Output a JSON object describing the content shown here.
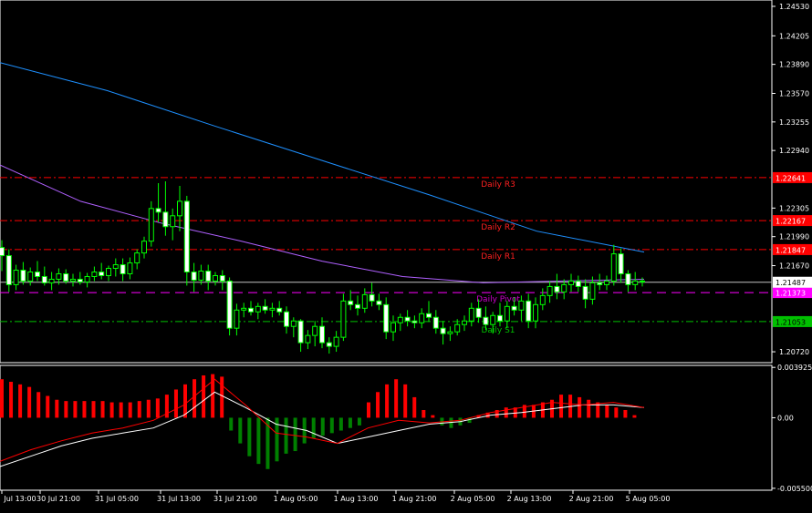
{
  "chart_data": [
    {
      "type": "candlestick",
      "title": "",
      "price_axis": {
        "ticks": [
          "1.24530",
          "1.24205",
          "1.23890",
          "1.23570",
          "1.23255",
          "1.22940",
          "1.22305",
          "1.21990",
          "1.21670",
          "1.20720"
        ],
        "ylim": [
          1.206,
          1.246
        ]
      },
      "levels": [
        {
          "name": "Daily R3",
          "value": 1.22641,
          "value_label": "1.22641",
          "color": "#ff0000",
          "style": "dashdot",
          "label_color": "#ff2020"
        },
        {
          "name": "Daily R2",
          "value": 1.22167,
          "value_label": "1.22167",
          "color": "#ff0000",
          "style": "dashdot",
          "label_color": "#ff2020"
        },
        {
          "name": "Daily R1",
          "value": 1.21847,
          "value_label": "1.21847",
          "color": "#ff0000",
          "style": "dashdot",
          "label_color": "#ff2020"
        },
        {
          "name": "Daily Pivot",
          "value": 1.21373,
          "value_label": "1.21373",
          "color": "#ff00ff",
          "style": "dashed",
          "label_color": "#cc00cc"
        },
        {
          "name": "Daily S1",
          "value": 1.21053,
          "value_label": "1.21053",
          "color": "#00c000",
          "style": "dashdot",
          "label_color": "#00c000"
        }
      ],
      "current_price": {
        "value": 1.21487,
        "label": "1.21487"
      },
      "candles": [
        {
          "o": 1.2187,
          "h": 1.2195,
          "l": 1.2161,
          "c": 1.2178
        },
        {
          "o": 1.2178,
          "h": 1.2185,
          "l": 1.2138,
          "c": 1.2146
        },
        {
          "o": 1.2146,
          "h": 1.2168,
          "l": 1.214,
          "c": 1.2162
        },
        {
          "o": 1.2162,
          "h": 1.2171,
          "l": 1.2146,
          "c": 1.215
        },
        {
          "o": 1.215,
          "h": 1.2165,
          "l": 1.2145,
          "c": 1.216
        },
        {
          "o": 1.216,
          "h": 1.2172,
          "l": 1.215,
          "c": 1.2155
        },
        {
          "o": 1.2155,
          "h": 1.2166,
          "l": 1.2145,
          "c": 1.2148
        },
        {
          "o": 1.2148,
          "h": 1.216,
          "l": 1.214,
          "c": 1.2152
        },
        {
          "o": 1.2152,
          "h": 1.2164,
          "l": 1.2146,
          "c": 1.2158
        },
        {
          "o": 1.2158,
          "h": 1.2163,
          "l": 1.2147,
          "c": 1.215
        },
        {
          "o": 1.215,
          "h": 1.2158,
          "l": 1.2144,
          "c": 1.2152
        },
        {
          "o": 1.2152,
          "h": 1.216,
          "l": 1.2146,
          "c": 1.2149
        },
        {
          "o": 1.2149,
          "h": 1.2159,
          "l": 1.2143,
          "c": 1.2155
        },
        {
          "o": 1.2155,
          "h": 1.2166,
          "l": 1.215,
          "c": 1.216
        },
        {
          "o": 1.216,
          "h": 1.217,
          "l": 1.2152,
          "c": 1.2156
        },
        {
          "o": 1.2156,
          "h": 1.2167,
          "l": 1.215,
          "c": 1.2164
        },
        {
          "o": 1.2164,
          "h": 1.2175,
          "l": 1.2155,
          "c": 1.2168
        },
        {
          "o": 1.2168,
          "h": 1.2175,
          "l": 1.215,
          "c": 1.2158
        },
        {
          "o": 1.2158,
          "h": 1.2176,
          "l": 1.2152,
          "c": 1.217
        },
        {
          "o": 1.217,
          "h": 1.2185,
          "l": 1.2163,
          "c": 1.2181
        },
        {
          "o": 1.2181,
          "h": 1.2199,
          "l": 1.2175,
          "c": 1.2194
        },
        {
          "o": 1.2194,
          "h": 1.2238,
          "l": 1.2188,
          "c": 1.223
        },
        {
          "o": 1.223,
          "h": 1.2258,
          "l": 1.2215,
          "c": 1.2226
        },
        {
          "o": 1.2226,
          "h": 1.226,
          "l": 1.22,
          "c": 1.221
        },
        {
          "o": 1.221,
          "h": 1.223,
          "l": 1.2195,
          "c": 1.2222
        },
        {
          "o": 1.2222,
          "h": 1.2255,
          "l": 1.2205,
          "c": 1.2238
        },
        {
          "o": 1.2238,
          "h": 1.2244,
          "l": 1.2145,
          "c": 1.216
        },
        {
          "o": 1.216,
          "h": 1.217,
          "l": 1.2138,
          "c": 1.2151
        },
        {
          "o": 1.2151,
          "h": 1.2168,
          "l": 1.2146,
          "c": 1.2161
        },
        {
          "o": 1.2161,
          "h": 1.2168,
          "l": 1.214,
          "c": 1.215
        },
        {
          "o": 1.215,
          "h": 1.216,
          "l": 1.2145,
          "c": 1.2156
        },
        {
          "o": 1.2156,
          "h": 1.2162,
          "l": 1.214,
          "c": 1.215
        },
        {
          "o": 1.215,
          "h": 1.2154,
          "l": 1.209,
          "c": 1.2098
        },
        {
          "o": 1.2098,
          "h": 1.2125,
          "l": 1.209,
          "c": 1.2118
        },
        {
          "o": 1.2118,
          "h": 1.2126,
          "l": 1.211,
          "c": 1.212
        },
        {
          "o": 1.212,
          "h": 1.2128,
          "l": 1.2112,
          "c": 1.2116
        },
        {
          "o": 1.2116,
          "h": 1.2126,
          "l": 1.2108,
          "c": 1.2122
        },
        {
          "o": 1.2122,
          "h": 1.213,
          "l": 1.2114,
          "c": 1.2118
        },
        {
          "o": 1.2118,
          "h": 1.2126,
          "l": 1.211,
          "c": 1.212
        },
        {
          "o": 1.212,
          "h": 1.2128,
          "l": 1.2112,
          "c": 1.2116
        },
        {
          "o": 1.2116,
          "h": 1.2122,
          "l": 1.2092,
          "c": 1.21
        },
        {
          "o": 1.21,
          "h": 1.211,
          "l": 1.2088,
          "c": 1.2106
        },
        {
          "o": 1.2106,
          "h": 1.2108,
          "l": 1.2072,
          "c": 1.2082
        },
        {
          "o": 1.2082,
          "h": 1.2096,
          "l": 1.2075,
          "c": 1.209
        },
        {
          "o": 1.209,
          "h": 1.2106,
          "l": 1.2078,
          "c": 1.21
        },
        {
          "o": 1.21,
          "h": 1.211,
          "l": 1.2076,
          "c": 1.2082
        },
        {
          "o": 1.2082,
          "h": 1.2088,
          "l": 1.207,
          "c": 1.2078
        },
        {
          "o": 1.2078,
          "h": 1.2095,
          "l": 1.2072,
          "c": 1.2088
        },
        {
          "o": 1.2088,
          "h": 1.2136,
          "l": 1.2084,
          "c": 1.2128
        },
        {
          "o": 1.2128,
          "h": 1.214,
          "l": 1.2118,
          "c": 1.2124
        },
        {
          "o": 1.2124,
          "h": 1.2134,
          "l": 1.2112,
          "c": 1.212
        },
        {
          "o": 1.212,
          "h": 1.2142,
          "l": 1.2115,
          "c": 1.2135
        },
        {
          "o": 1.2135,
          "h": 1.2148,
          "l": 1.2122,
          "c": 1.2128
        },
        {
          "o": 1.2128,
          "h": 1.2136,
          "l": 1.2118,
          "c": 1.2124
        },
        {
          "o": 1.2124,
          "h": 1.2132,
          "l": 1.2086,
          "c": 1.2094
        },
        {
          "o": 1.2094,
          "h": 1.2112,
          "l": 1.2084,
          "c": 1.2104
        },
        {
          "o": 1.2104,
          "h": 1.2114,
          "l": 1.2095,
          "c": 1.211
        },
        {
          "o": 1.211,
          "h": 1.2118,
          "l": 1.21,
          "c": 1.2106
        },
        {
          "o": 1.2106,
          "h": 1.2112,
          "l": 1.2098,
          "c": 1.2104
        },
        {
          "o": 1.2104,
          "h": 1.212,
          "l": 1.2098,
          "c": 1.2114
        },
        {
          "o": 1.2114,
          "h": 1.2128,
          "l": 1.2105,
          "c": 1.211
        },
        {
          "o": 1.211,
          "h": 1.2118,
          "l": 1.2092,
          "c": 1.2098
        },
        {
          "o": 1.2098,
          "h": 1.2106,
          "l": 1.208,
          "c": 1.2092
        },
        {
          "o": 1.2092,
          "h": 1.21,
          "l": 1.2084,
          "c": 1.2094
        },
        {
          "o": 1.2094,
          "h": 1.2108,
          "l": 1.209,
          "c": 1.2102
        },
        {
          "o": 1.2102,
          "h": 1.2112,
          "l": 1.2095,
          "c": 1.2106
        },
        {
          "o": 1.2106,
          "h": 1.2126,
          "l": 1.21,
          "c": 1.212
        },
        {
          "o": 1.212,
          "h": 1.213,
          "l": 1.2104,
          "c": 1.211
        },
        {
          "o": 1.211,
          "h": 1.2122,
          "l": 1.2096,
          "c": 1.2102
        },
        {
          "o": 1.2102,
          "h": 1.2116,
          "l": 1.2092,
          "c": 1.2112
        },
        {
          "o": 1.2112,
          "h": 1.2126,
          "l": 1.21,
          "c": 1.2106
        },
        {
          "o": 1.2106,
          "h": 1.2128,
          "l": 1.2098,
          "c": 1.2122
        },
        {
          "o": 1.2122,
          "h": 1.2132,
          "l": 1.2112,
          "c": 1.2118
        },
        {
          "o": 1.2118,
          "h": 1.2134,
          "l": 1.2106,
          "c": 1.2128
        },
        {
          "o": 1.2128,
          "h": 1.2136,
          "l": 1.2098,
          "c": 1.2106
        },
        {
          "o": 1.2106,
          "h": 1.2132,
          "l": 1.2098,
          "c": 1.2124
        },
        {
          "o": 1.2124,
          "h": 1.2142,
          "l": 1.2118,
          "c": 1.2134
        },
        {
          "o": 1.2134,
          "h": 1.215,
          "l": 1.2126,
          "c": 1.2144
        },
        {
          "o": 1.2144,
          "h": 1.2158,
          "l": 1.213,
          "c": 1.2138
        },
        {
          "o": 1.2138,
          "h": 1.2152,
          "l": 1.213,
          "c": 1.2146
        },
        {
          "o": 1.2146,
          "h": 1.2158,
          "l": 1.2138,
          "c": 1.215
        },
        {
          "o": 1.215,
          "h": 1.2156,
          "l": 1.2138,
          "c": 1.2144
        },
        {
          "o": 1.2144,
          "h": 1.2152,
          "l": 1.212,
          "c": 1.213
        },
        {
          "o": 1.213,
          "h": 1.2155,
          "l": 1.2124,
          "c": 1.2148
        },
        {
          "o": 1.2148,
          "h": 1.2158,
          "l": 1.214,
          "c": 1.2146
        },
        {
          "o": 1.2146,
          "h": 1.2156,
          "l": 1.214,
          "c": 1.215
        },
        {
          "o": 1.215,
          "h": 1.219,
          "l": 1.2145,
          "c": 1.218
        },
        {
          "o": 1.218,
          "h": 1.2186,
          "l": 1.2148,
          "c": 1.2158
        },
        {
          "o": 1.2158,
          "h": 1.2162,
          "l": 1.2138,
          "c": 1.2146
        },
        {
          "o": 1.2146,
          "h": 1.216,
          "l": 1.214,
          "c": 1.215
        },
        {
          "o": 1.215,
          "h": 1.2154,
          "l": 1.2144,
          "c": 1.2149
        }
      ],
      "ma_blue": {
        "color": "#1e90ff",
        "values": [
          1.2391,
          1.236,
          1.2321,
          1.2283,
          1.2245,
          1.2205,
          1.2182
        ]
      },
      "ma_violet": {
        "color": "#b060ff",
        "values": [
          1.2278,
          1.2238,
          1.2214,
          1.2194,
          1.2172,
          1.2155,
          1.2148,
          1.215,
          1.2152
        ]
      }
    },
    {
      "type": "histogram",
      "title": "",
      "oscillator_axis": {
        "ticks": [
          "0.003925",
          "0.00",
          "-0.005500"
        ],
        "ylim": [
          -0.00565,
          0.00408
        ]
      },
      "histogram": {
        "positive_color": "#ff0000",
        "negative_color": "#008000",
        "values": [
          0.003,
          0.0028,
          0.0026,
          0.0024,
          0.002,
          0.0017,
          0.0014,
          0.0013,
          0.0013,
          0.0013,
          0.0013,
          0.0013,
          0.0012,
          0.0012,
          0.0012,
          0.0013,
          0.0014,
          0.0015,
          0.0018,
          0.0022,
          0.0026,
          0.003,
          0.0033,
          0.0034,
          0.0032,
          -0.001,
          -0.002,
          -0.003,
          -0.0036,
          -0.004,
          -0.0034,
          -0.0028,
          -0.0026,
          -0.002,
          -0.0016,
          -0.0014,
          -0.0012,
          -0.001,
          -0.0008,
          -0.0006,
          0.0012,
          0.002,
          0.0026,
          0.003,
          0.0026,
          0.0016,
          0.0006,
          0.0002,
          -0.0006,
          -0.0008,
          -0.0006,
          -0.0004,
          0.0002,
          0.0004,
          0.0006,
          0.0008,
          0.0008,
          0.001,
          0.001,
          0.0012,
          0.0014,
          0.0018,
          0.0018,
          0.0016,
          0.0014,
          0.0012,
          0.001,
          0.0008,
          0.0006,
          0.0002
        ],
        "bar_colors_override": {
          "0": "r"
        }
      },
      "signal_lines": [
        {
          "name": "",
          "color": "#ffffff",
          "values": [
            -0.0038,
            -0.003,
            -0.0022,
            -0.0016,
            -0.0012,
            -0.0008,
            0.0002,
            0.002,
            0.0008,
            -0.0005,
            -0.001,
            -0.002,
            -0.0015,
            -0.001,
            -0.0005,
            -0.0003,
            0.0002,
            0.0004,
            0.0007,
            0.001,
            0.001,
            0.0008
          ]
        },
        {
          "name": "",
          "color": "#ff0000",
          "values": [
            -0.0034,
            -0.0025,
            -0.0018,
            -0.0012,
            -0.0008,
            -0.0002,
            0.001,
            0.003,
            0.001,
            -0.0012,
            -0.0015,
            -0.002,
            -0.0008,
            -0.0002,
            -0.0004,
            -0.0002,
            0.0004,
            0.0008,
            0.0012,
            0.001,
            0.0012,
            0.0008
          ]
        }
      ]
    }
  ],
  "time_axis": {
    "labels": [
      "Jul 13:00",
      "30 Jul 21:00",
      "31 Jul 05:00",
      "31 Jul 13:00",
      "31 Jul 21:00",
      "1 Aug 05:00",
      "1 Aug 13:00",
      "1 Aug 21:00",
      "2 Aug 05:00",
      "2 Aug 13:00",
      "2 Aug 21:00",
      "5 Aug 05:00"
    ]
  }
}
